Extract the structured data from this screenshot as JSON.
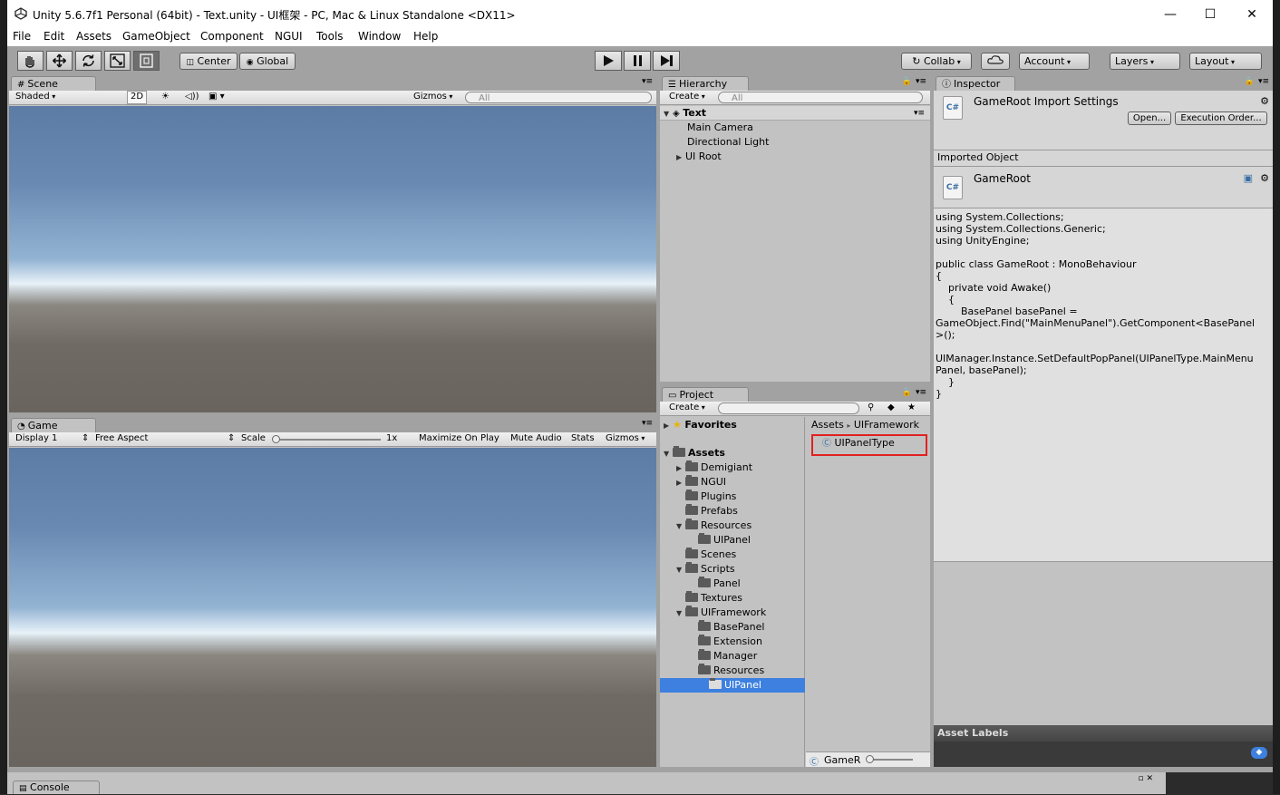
{
  "window": {
    "title": "Unity 5.6.7f1 Personal (64bit) - Text.unity - UI框架 - PC, Mac & Linux Standalone <DX11>",
    "minimize": "—",
    "maximize": "☐",
    "close": "✕"
  },
  "menu": [
    "File",
    "Edit",
    "Assets",
    "GameObject",
    "Component",
    "NGUI",
    "Tools",
    "Window",
    "Help"
  ],
  "toolbar": {
    "center": "Center",
    "global": "Global",
    "collab": "Collab",
    "account": "Account",
    "layers": "Layers",
    "layout": "Layout"
  },
  "scene": {
    "tab": "Scene",
    "shaded": "Shaded",
    "mode2d": "2D",
    "gizmos": "Gizmos",
    "search": "All"
  },
  "game": {
    "tab": "Game",
    "display": "Display 1",
    "aspect": "Free Aspect",
    "scale_label": "Scale",
    "scale_value": "1x",
    "maximize": "Maximize On Play",
    "mute": "Mute Audio",
    "stats": "Stats",
    "gizmos": "Gizmos"
  },
  "hierarchy": {
    "tab": "Hierarchy",
    "create": "Create",
    "search": "All",
    "scene_name": "Text",
    "items": [
      "Main Camera",
      "Directional Light",
      "UI Root"
    ]
  },
  "project": {
    "tab": "Project",
    "create": "Create",
    "favorites": "Favorites",
    "assets": "Assets",
    "folders": [
      {
        "name": "Demigiant",
        "level": 1,
        "arrow": "▶"
      },
      {
        "name": "NGUI",
        "level": 1,
        "arrow": "▶"
      },
      {
        "name": "Plugins",
        "level": 1,
        "arrow": ""
      },
      {
        "name": "Prefabs",
        "level": 1,
        "arrow": ""
      },
      {
        "name": "Resources",
        "level": 1,
        "arrow": "▼"
      },
      {
        "name": "UIPanel",
        "level": 2,
        "arrow": ""
      },
      {
        "name": "Scenes",
        "level": 1,
        "arrow": ""
      },
      {
        "name": "Scripts",
        "level": 1,
        "arrow": "▼"
      },
      {
        "name": "Panel",
        "level": 2,
        "arrow": ""
      },
      {
        "name": "Textures",
        "level": 1,
        "arrow": ""
      },
      {
        "name": "UIFramework",
        "level": 1,
        "arrow": "▼"
      },
      {
        "name": "BasePanel",
        "level": 2,
        "arrow": ""
      },
      {
        "name": "Extension",
        "level": 2,
        "arrow": ""
      },
      {
        "name": "Manager",
        "level": 2,
        "arrow": ""
      },
      {
        "name": "Resources",
        "level": 2,
        "arrow": ""
      },
      {
        "name": "UIPanel",
        "level": 2,
        "arrow": "",
        "selected": true
      }
    ],
    "breadcrumb_root": "Assets",
    "breadcrumb_sep": "▸",
    "breadcrumb_folder": "UIFramework",
    "file": "UIPanelType",
    "footer_file": "GameR"
  },
  "inspector": {
    "tab": "Inspector",
    "header_title": "GameRoot Import Settings",
    "open": "Open...",
    "exec_order": "Execution Order...",
    "imported_object": "Imported Object",
    "object_name": "GameRoot",
    "code": "using System.Collections;\nusing System.Collections.Generic;\nusing UnityEngine;\n\npublic class GameRoot : MonoBehaviour\n{\n    private void Awake()\n    {\n        BasePanel basePanel =\nGameObject.Find(\"MainMenuPanel\").GetComponent<BasePanel\n>();\n\nUIManager.Instance.SetDefaultPopPanel(UIPanelType.MainMenu\nPanel, basePanel);\n    }\n}",
    "asset_labels": "Asset Labels",
    "cs_label": "C#"
  },
  "console": {
    "tab": "Console"
  },
  "colors": {
    "selection": "#3d80df",
    "highlight_box": "#e02020",
    "panel": "#c2c2c2"
  }
}
